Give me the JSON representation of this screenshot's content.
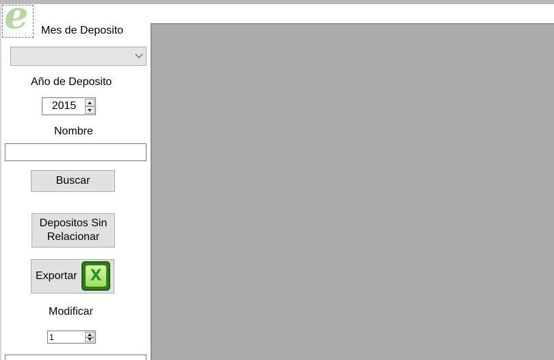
{
  "logo": {
    "glyph": "e"
  },
  "labels": {
    "month": "Mes de Deposito",
    "year": "Año de Deposito",
    "name": "Nombre",
    "modify": "Modificar"
  },
  "month_select": {
    "selected": ""
  },
  "year_spinner": {
    "value": "2015"
  },
  "name_input": {
    "value": ""
  },
  "buttons": {
    "search": "Buscar",
    "unrelated_line1": "Depositos Sin",
    "unrelated_line2": "Relacionar",
    "export": "Exportar"
  },
  "modify_spinner": {
    "value": "1"
  },
  "colors": {
    "panel": "#ababab",
    "logo": "#b8d6a4",
    "excel": "#2f7d1c"
  }
}
